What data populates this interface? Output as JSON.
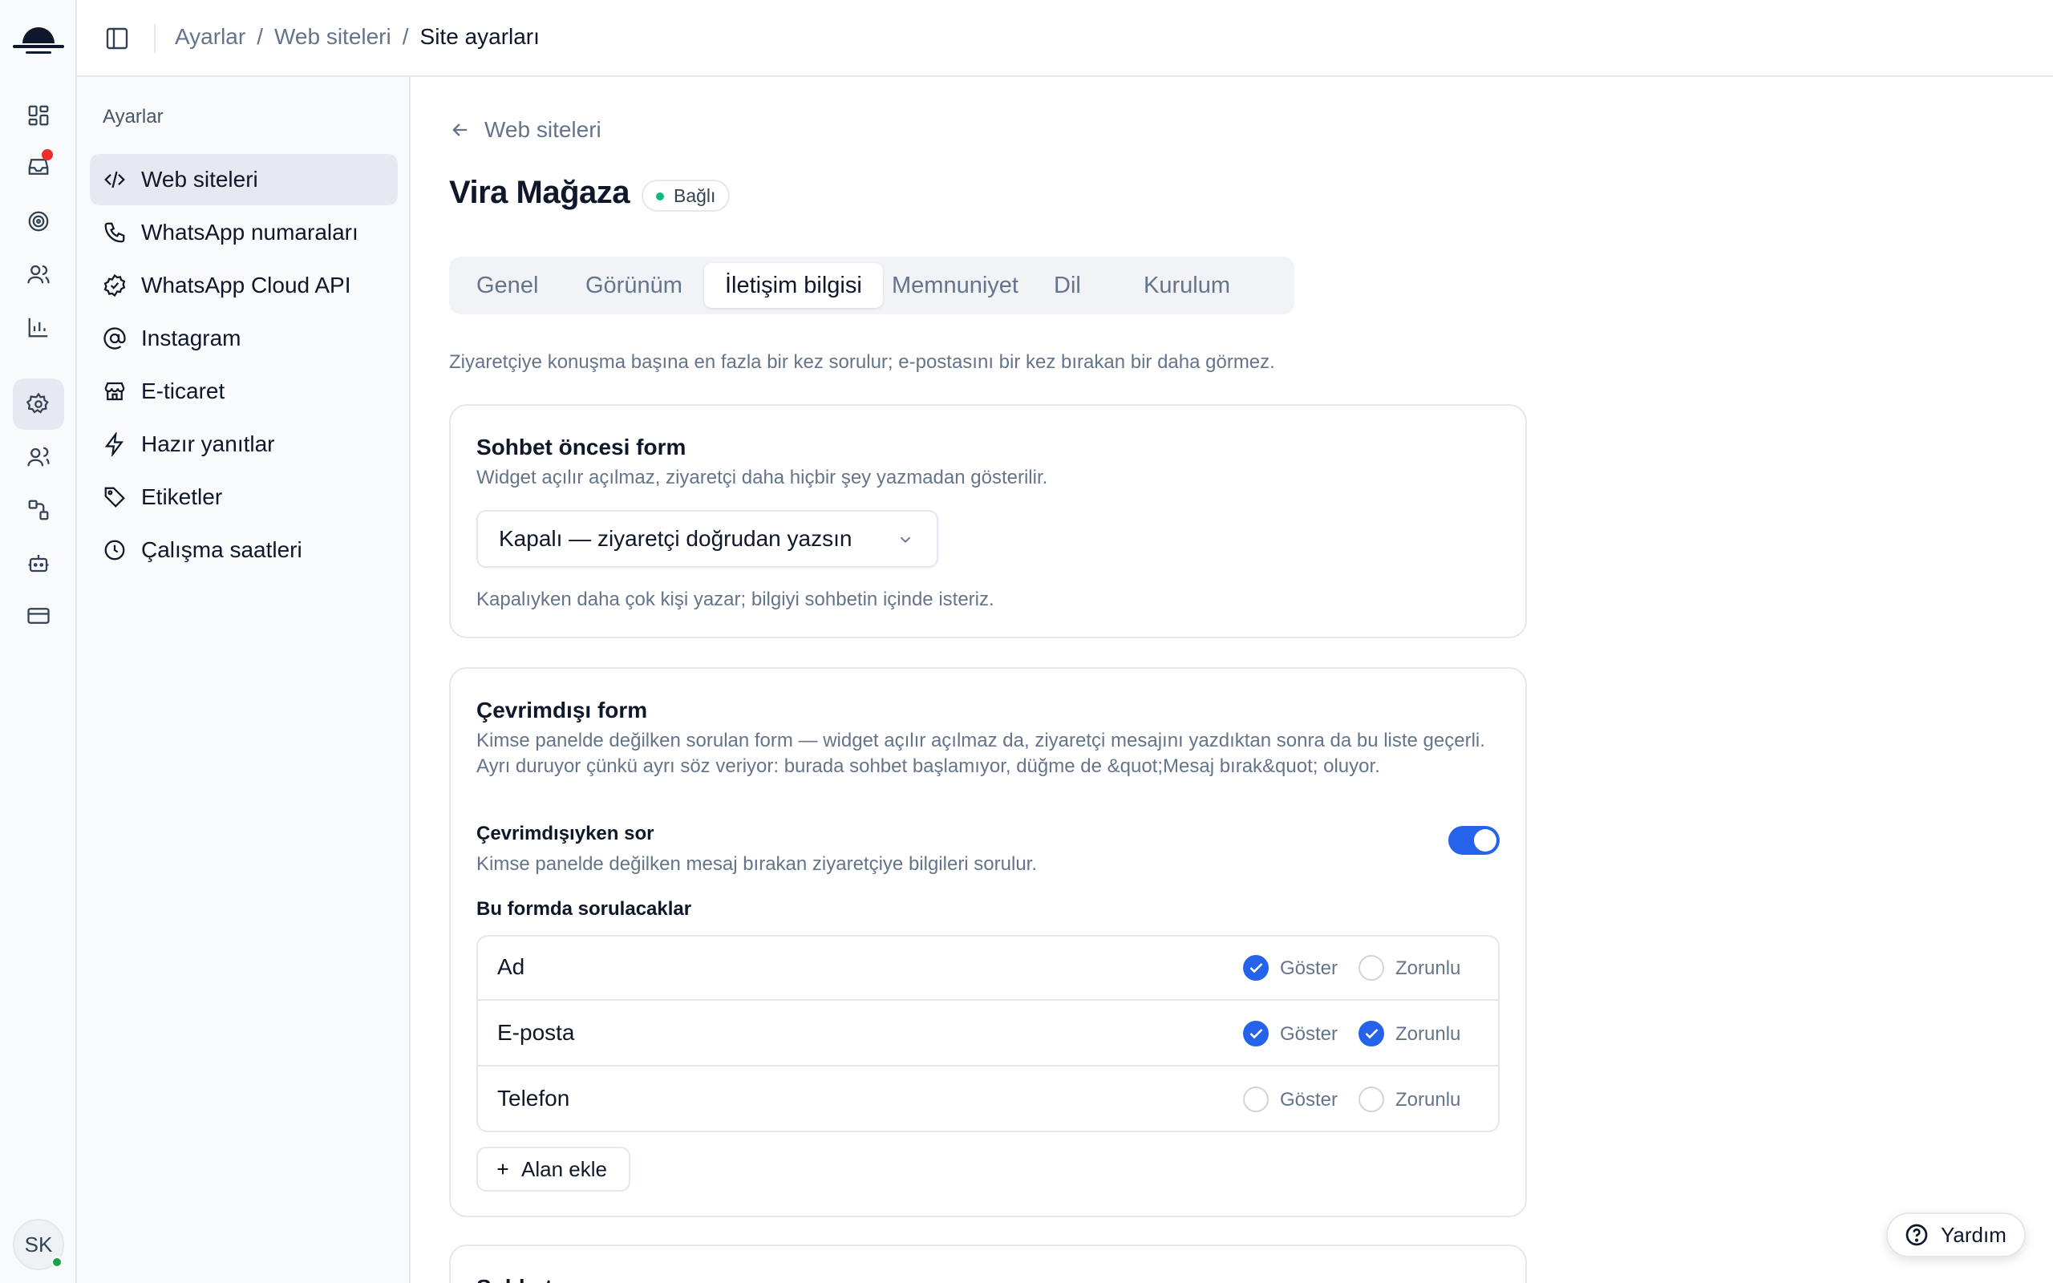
{
  "breadcrumb": {
    "item1": "Ayarlar",
    "item2": "Web siteleri",
    "current": "Site ayarları",
    "sep": "/"
  },
  "settings_nav": {
    "title": "Ayarlar",
    "items": [
      {
        "label": "Web siteleri",
        "icon": "code-icon",
        "active": true
      },
      {
        "label": "WhatsApp numaraları",
        "icon": "phone-icon"
      },
      {
        "label": "WhatsApp Cloud API",
        "icon": "badge-check-icon"
      },
      {
        "label": "Instagram",
        "icon": "at-sign-icon"
      },
      {
        "label": "E-ticaret",
        "icon": "store-icon"
      },
      {
        "label": "Hazır yanıtlar",
        "icon": "zap-icon"
      },
      {
        "label": "Etiketler",
        "icon": "tag-icon"
      },
      {
        "label": "Çalışma saatleri",
        "icon": "clock-icon"
      }
    ]
  },
  "rail": {
    "items": [
      "dashboard-icon",
      "inbox-icon",
      "target-icon",
      "contacts-icon",
      "chart-icon",
      "settings-icon",
      "team-icon",
      "workflow-icon",
      "bot-icon",
      "billing-icon"
    ],
    "avatar_initials": "SK"
  },
  "main": {
    "back_label": "Web siteleri",
    "site_name": "Vira Mağaza",
    "status": "Bağlı",
    "tabs": [
      "Genel",
      "Görünüm",
      "İletişim bilgisi",
      "Memnuniyet",
      "Dil",
      "Kurulum"
    ],
    "active_tab": "İletişim bilgisi",
    "intro": "Ziyaretçiye konuşma başına en fazla bir kez sorulur; e-postasını bir kez bırakan bir daha görmez.",
    "prechat": {
      "title": "Sohbet öncesi form",
      "desc": "Widget açılır açılmaz, ziyaretçi daha hiçbir şey yazmadan gösterilir.",
      "select_value": "Kapalı — ziyaretçi doğrudan yazsın",
      "hint": "Kapalıyken daha çok kişi yazar; bilgiyi sohbetin içinde isteriz."
    },
    "offline": {
      "title": "Çevrimdışı form",
      "desc": "Kimse panelde değilken sorulan form — widget açılır açılmaz da, ziyaretçi mesajını yazdıktan sonra da bu liste geçerli. Ayrı duruyor çünkü ayrı söz veriyor: burada sohbet başlamıyor, düğme de &quot;Mesaj bırak&quot; oluyor.",
      "toggle_label": "Çevrimdışıyken sor",
      "toggle_desc": "Kimse panelde değilken mesaj bırakan ziyaretçiye bilgileri sorulur.",
      "toggle_on": true,
      "fields_title": "Bu formda sorulacaklar",
      "show_label": "Göster",
      "required_label": "Zorunlu",
      "fields": [
        {
          "name": "Ad",
          "show": true,
          "required": false
        },
        {
          "name": "E-posta",
          "show": true,
          "required": true
        },
        {
          "name": "Telefon",
          "show": false,
          "required": false
        }
      ],
      "add_label": "Alan ekle"
    },
    "next_card_title": "Sohbet sonrası"
  },
  "help_label": "Yardım",
  "colors": {
    "accent": "#2563eb",
    "status_dot": "#10b981",
    "notification": "#ef2b2b"
  }
}
